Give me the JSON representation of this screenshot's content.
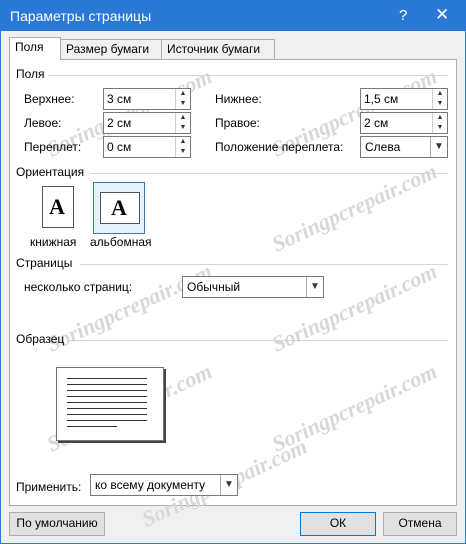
{
  "window": {
    "title": "Параметры страницы",
    "help": "?",
    "close": "✕"
  },
  "tabs": [
    "Поля",
    "Размер бумаги",
    "Источник бумаги"
  ],
  "margins": {
    "title": "Поля",
    "top": {
      "label": "Верхнее:",
      "value": "3 см"
    },
    "bottom": {
      "label": "Нижнее:",
      "value": "1,5 см"
    },
    "left": {
      "label": "Левое:",
      "value": "2 см"
    },
    "right": {
      "label": "Правое:",
      "value": "2 см"
    },
    "gutter": {
      "label": "Переплет:",
      "value": "0 см"
    },
    "gutter_pos": {
      "label": "Положение переплета:",
      "value": "Слева"
    }
  },
  "orientation": {
    "title": "Ориентация",
    "portrait": "книжная",
    "landscape": "альбомная",
    "glyph": "A",
    "selected": "landscape"
  },
  "pages": {
    "title": "Страницы",
    "multiple_label": "несколько страниц:",
    "multiple_value": "Обычный"
  },
  "preview": {
    "title": "Образец"
  },
  "apply": {
    "label": "Применить:",
    "value": "ко всему документу"
  },
  "buttons": {
    "default": "По умолчанию",
    "ok": "ОК",
    "cancel": "Отмена"
  },
  "watermark": "Soringpcrepair.com",
  "colors": {
    "titlebar": "#2b79d6",
    "selected_border": "#3c7fb1",
    "ok_border": "#0078d7"
  }
}
